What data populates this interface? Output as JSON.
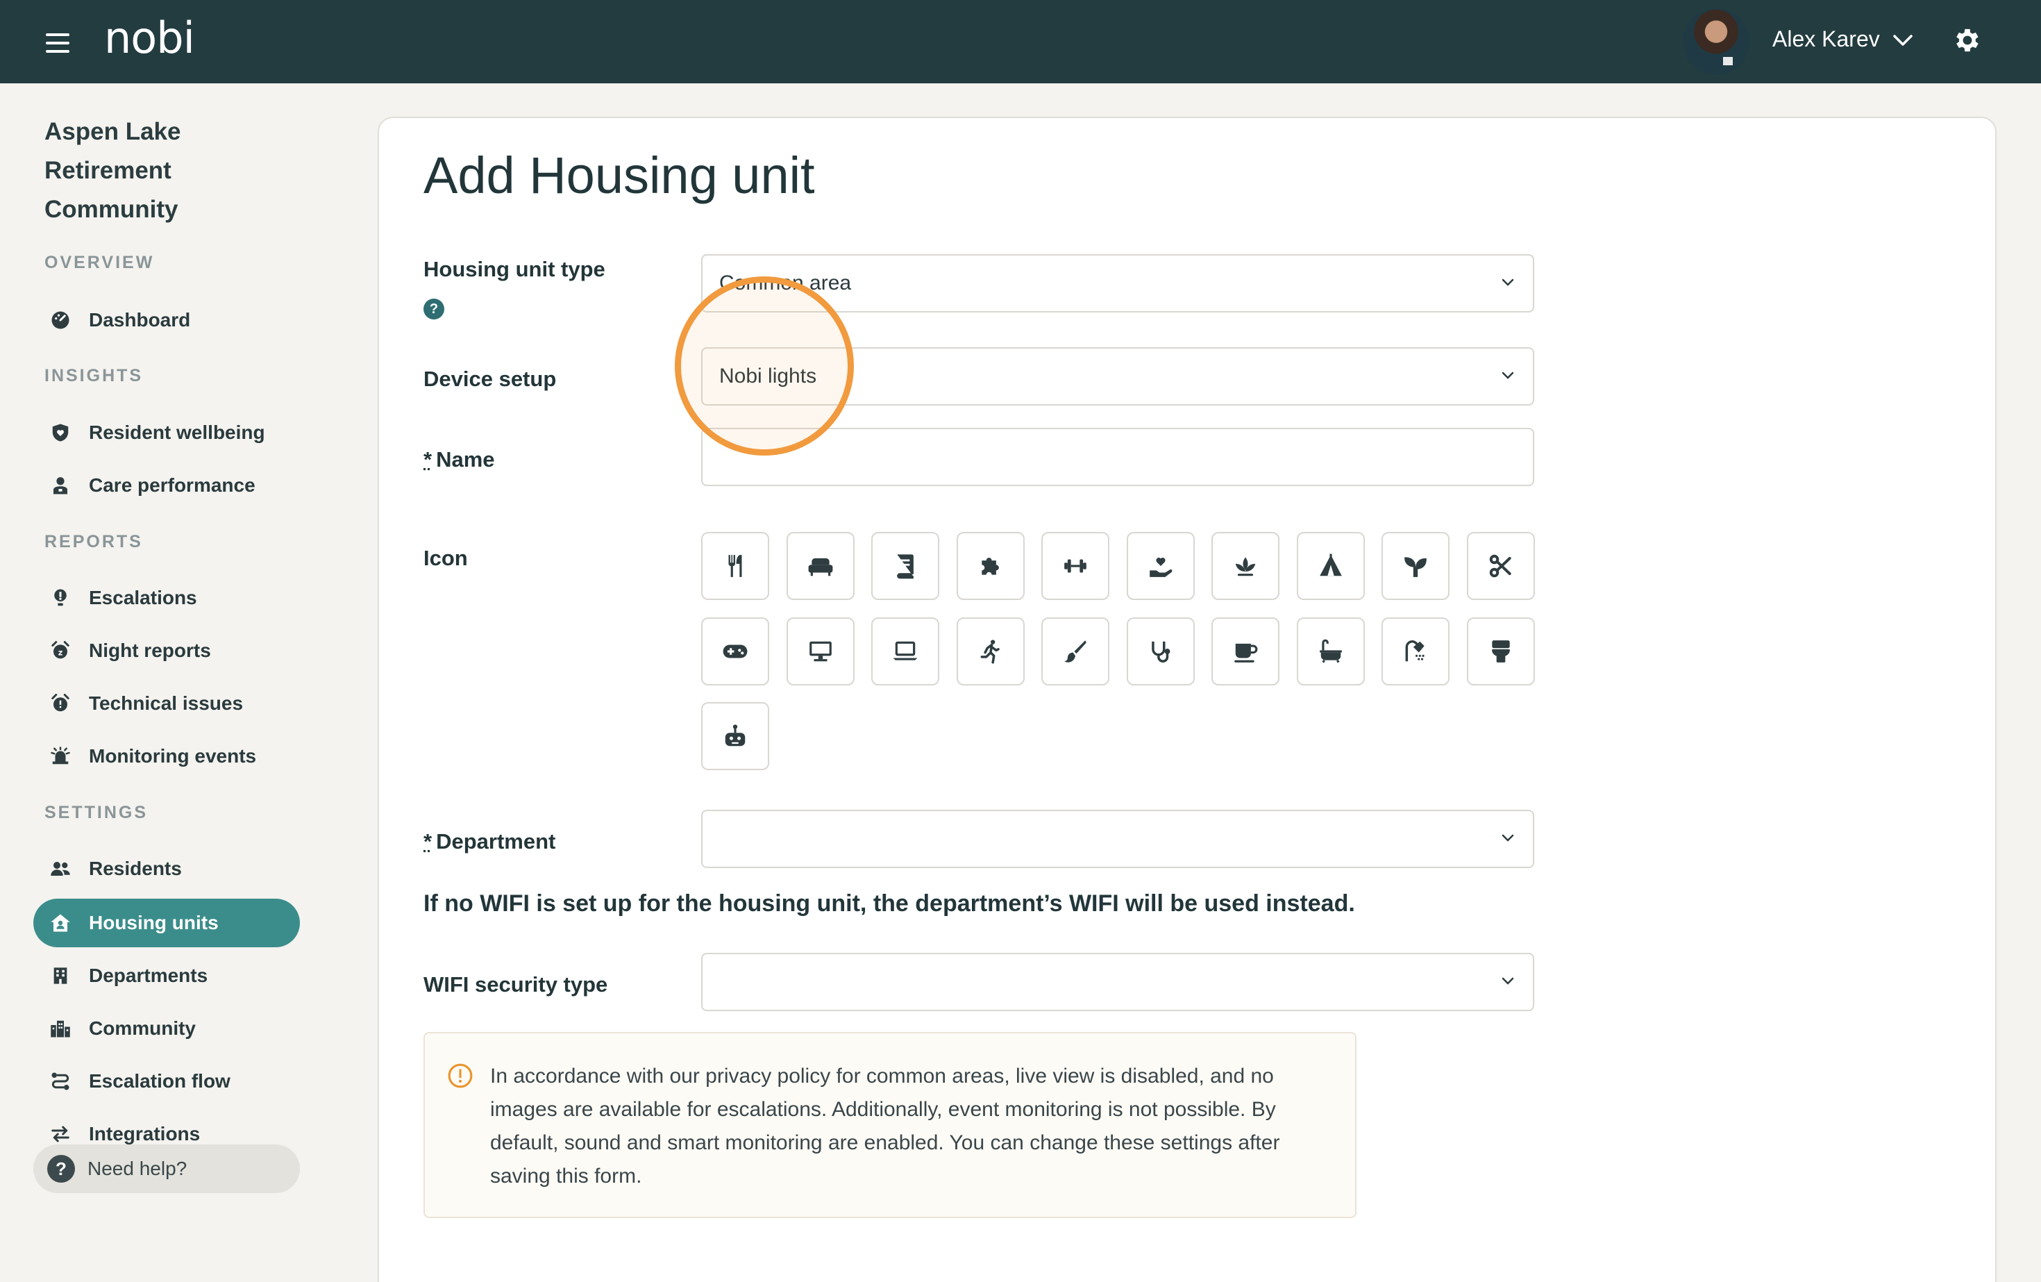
{
  "topbar": {
    "logo": "nobi",
    "user_name": "Alex Karev"
  },
  "sidebar": {
    "org_name": "Aspen Lake Retirement Community",
    "sections": {
      "overview": "OVERVIEW",
      "insights": "INSIGHTS",
      "reports": "REPORTS",
      "settings": "SETTINGS"
    },
    "items": {
      "dashboard": "Dashboard",
      "resident_wellbeing": "Resident wellbeing",
      "care_performance": "Care performance",
      "escalations": "Escalations",
      "night_reports": "Night reports",
      "technical_issues": "Technical issues",
      "monitoring_events": "Monitoring events",
      "residents": "Residents",
      "housing_units": "Housing units",
      "departments": "Departments",
      "community": "Community",
      "escalation_flow": "Escalation flow",
      "integrations": "Integrations"
    },
    "active_item": "housing_units",
    "help_label": "Need help?"
  },
  "form": {
    "title": "Add Housing unit",
    "housing_unit_type": {
      "label": "Housing unit type",
      "value": "Common area"
    },
    "device_setup": {
      "label": "Device setup",
      "value": "Nobi lights"
    },
    "name": {
      "label": "Name",
      "required_mark": "*",
      "value": ""
    },
    "icon": {
      "label": "Icon",
      "options": [
        "fork-knife",
        "sofa",
        "book",
        "puzzle",
        "dumbbell",
        "hand-heart",
        "lotus",
        "tent",
        "sprout",
        "scissors",
        "gamepad",
        "desktop",
        "laptop",
        "person-running",
        "paintbrush",
        "stethoscope",
        "mug",
        "bath",
        "shower",
        "toilet",
        "robot"
      ]
    },
    "department": {
      "label": "Department",
      "required_mark": "*",
      "value": ""
    },
    "wifi_note": "If no WIFI is set up for the housing unit, the department’s WIFI will be used instead.",
    "wifi_security": {
      "label": "WIFI security type",
      "value": ""
    },
    "privacy_notice": "In accordance with our privacy policy for common areas, live view is disabled, and no images are available for escalations. Additionally, event monitoring is not possible. By default, sound and smart monitoring are enabled. You can change these settings after saving this form."
  },
  "colors": {
    "topbar": "#233c40",
    "accent": "#3b8d8b",
    "focus_ring": "#f19a3e",
    "warning": "#e8962e"
  }
}
